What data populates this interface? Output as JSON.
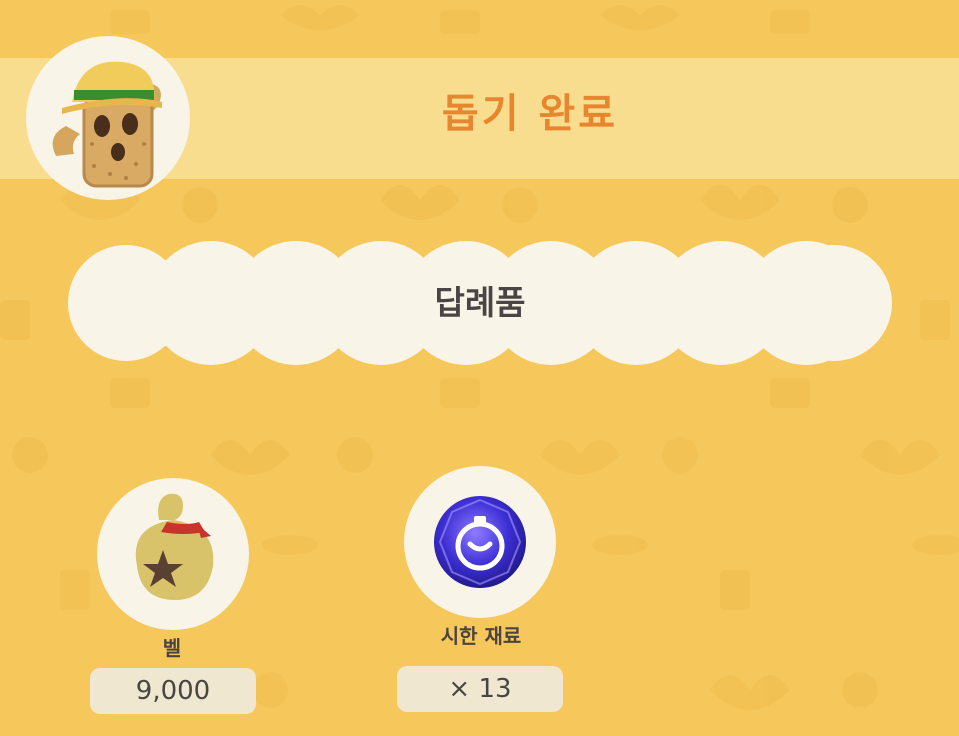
{
  "header": {
    "title": "돕기 완료",
    "avatar_icon": "cactus-helper-icon"
  },
  "rewards_panel": {
    "title": "답례품"
  },
  "rewards": [
    {
      "name": "벨",
      "count": "9,000",
      "icon": "bell-bag-icon"
    },
    {
      "name": "시한 재료",
      "count": "× 13",
      "icon": "timer-crystal-icon"
    }
  ],
  "colors": {
    "background": "#f6c85c",
    "header_band": "#f9dd8f",
    "title_orange": "#e8852f",
    "panel_white": "#f8f5e8",
    "text_dark": "#4a4544",
    "count_pill": "#efe7cf"
  }
}
